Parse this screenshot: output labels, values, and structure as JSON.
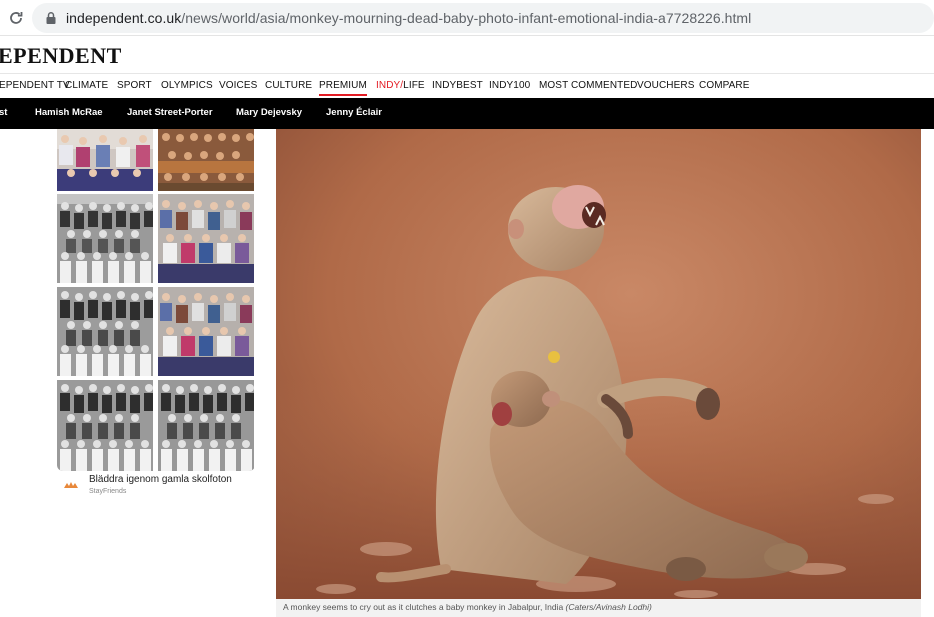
{
  "browser": {
    "url_domain": "independent.co.uk",
    "url_path": "/news/world/asia/monkey-mourning-dead-baby-photo-infant-emotional-india-a7728226.html"
  },
  "site": {
    "logo_text": "EPENDENT"
  },
  "nav": {
    "items": [
      "EPENDENT TV",
      "CLIMATE",
      "SPORT",
      "OLYMPICS",
      "VOICES",
      "CULTURE",
      "PREMIUM",
      "INDY/LIFE",
      "INDYBEST",
      "INDY100",
      "MOST COMMENTED",
      "VOUCHERS",
      "COMPARE"
    ],
    "indylife_a": "INDY/",
    "indylife_b": "LIFE",
    "active": "PREMIUM"
  },
  "subnav": {
    "items": [
      "st",
      "Hamish McRae",
      "Janet Street-Porter",
      "Mary Dejevsky",
      "Jenny Éclair"
    ]
  },
  "ad": {
    "title": "Bläddra igenom gamla skolfoton",
    "source": "StayFriends",
    "thumbnails": [
      "color-class-photo",
      "color-class-photo",
      "bw-class-photo",
      "color-class-photo",
      "bw-class-photo",
      "color-class-photo",
      "bw-class-photo",
      "bw-class-photo"
    ]
  },
  "article": {
    "caption_text": "A monkey seems to cry out as it clutches a baby monkey in Jabalpur, India ",
    "caption_credit": "(Caters/Avinash Lodhi)"
  },
  "colors": {
    "accent_red": "#e31b23",
    "subnav_bg": "#000000",
    "photo_bg": "#b7704f"
  }
}
